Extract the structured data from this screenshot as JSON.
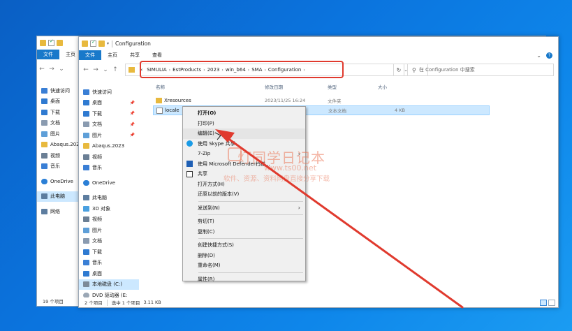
{
  "back_window": {
    "title": "",
    "ribbon": {
      "file": "文件",
      "home": "主页"
    },
    "nav": [
      {
        "label": "快速访问",
        "color": "#3a7fd5"
      },
      {
        "label": "桌面",
        "color": "#2f7ad1"
      },
      {
        "label": "下载",
        "color": "#2f7ad1"
      },
      {
        "label": "文档",
        "color": "#8a9bb0"
      },
      {
        "label": "图片",
        "color": "#5e9fd8"
      },
      {
        "label": "Abaqus.2023",
        "color": "#e8b93e"
      },
      {
        "label": "视频",
        "color": "#6b7f95"
      },
      {
        "label": "音乐",
        "color": "#3a7fd5"
      },
      {
        "label": "OneDrive",
        "color": "#2b7fd6"
      },
      {
        "label": "此电脑",
        "color": "#5d7d9f"
      },
      {
        "label": "网络",
        "color": "#5d7d9f"
      }
    ],
    "status": "19 个项目"
  },
  "front_window": {
    "title": "Configuration",
    "ribbon": {
      "file": "文件",
      "home": "主页",
      "share": "共享",
      "view": "查看"
    },
    "address": {
      "prefix": "«",
      "crumbs": [
        "SIMULIA",
        "EstProducts",
        "2023",
        "win_b64",
        "SMA",
        "Configuration"
      ]
    },
    "search_placeholder": "在 Configuration 中搜索",
    "nav": [
      {
        "label": "快速访问",
        "color": "#3a7fd5",
        "pin": false
      },
      {
        "label": "桌面",
        "color": "#2f7ad1",
        "pin": true
      },
      {
        "label": "下载",
        "color": "#2f7ad1",
        "pin": true
      },
      {
        "label": "文档",
        "color": "#8a9bb0",
        "pin": true
      },
      {
        "label": "图片",
        "color": "#5e9fd8",
        "pin": true
      },
      {
        "label": "Abaqus.2023",
        "color": "#e8b93e",
        "pin": false
      },
      {
        "label": "视频",
        "color": "#6b7f95",
        "pin": false
      },
      {
        "label": "音乐",
        "color": "#3a7fd5",
        "pin": false
      },
      {
        "label": "OneDrive",
        "color": "#2b7fd6",
        "pin": false
      },
      {
        "label": "此电脑",
        "color": "#5d7d9f",
        "pin": false
      },
      {
        "label": "3D 对象",
        "color": "#4aa0e0",
        "pin": false
      },
      {
        "label": "视频",
        "color": "#6b7f95",
        "pin": false
      },
      {
        "label": "图片",
        "color": "#5e9fd8",
        "pin": false
      },
      {
        "label": "文档",
        "color": "#8a9bb0",
        "pin": false
      },
      {
        "label": "下载",
        "color": "#2f7ad1",
        "pin": false
      },
      {
        "label": "音乐",
        "color": "#3a7fd5",
        "pin": false
      },
      {
        "label": "桌面",
        "color": "#2f7ad1",
        "pin": false
      },
      {
        "label": "本地磁盘 (C:)",
        "color": "#7c8a99",
        "pin": false
      },
      {
        "label": "DVD 驱动器 (E:",
        "color": "#9aa7b5",
        "pin": false
      },
      {
        "label": "网络",
        "color": "#5d7d9f",
        "pin": false
      }
    ],
    "columns": {
      "name": "名称",
      "date": "修改日期",
      "type": "类型",
      "size": "大小"
    },
    "files": [
      {
        "name": "Xresources",
        "date": "2023/11/25 16:24",
        "type": "文件夹",
        "size": "",
        "icon": "folder-icon"
      },
      {
        "name": "locale",
        "date": "",
        "type": "文本文档",
        "size": "4 KB",
        "icon": "text-file-icon"
      }
    ],
    "status": {
      "count": "2 个项目",
      "selected": "选中 1 个项目",
      "size": "3.11 KB"
    }
  },
  "context_menu": {
    "items": [
      {
        "label": "打开(O)",
        "bold": true
      },
      {
        "label": "打印(P)"
      },
      {
        "label": "编辑(E)"
      },
      {
        "label": "使用 Skype 共享"
      },
      {
        "label": "7-Zip"
      },
      {
        "label": "使用 Microsoft Defender扫描..."
      },
      {
        "label": "共享"
      },
      {
        "label": "打开方式(H)"
      },
      {
        "label": "还原以前的版本(V)"
      },
      {
        "label": "发送到(N)"
      },
      {
        "label": "剪切(T)"
      },
      {
        "label": "复制(C)"
      },
      {
        "label": "创建快捷方式(S)"
      },
      {
        "label": "删除(D)"
      },
      {
        "label": "重命名(M)"
      },
      {
        "label": "属性(R)"
      }
    ]
  },
  "watermark": {
    "title": "灯同学日记本",
    "url": "www.ts00.net",
    "subtitle": "软件、资源、资料网盘直接分享下载"
  },
  "colors": {
    "highlight": "#e03a2e",
    "accent": "#1979ca",
    "selection": "#cce8ff"
  }
}
